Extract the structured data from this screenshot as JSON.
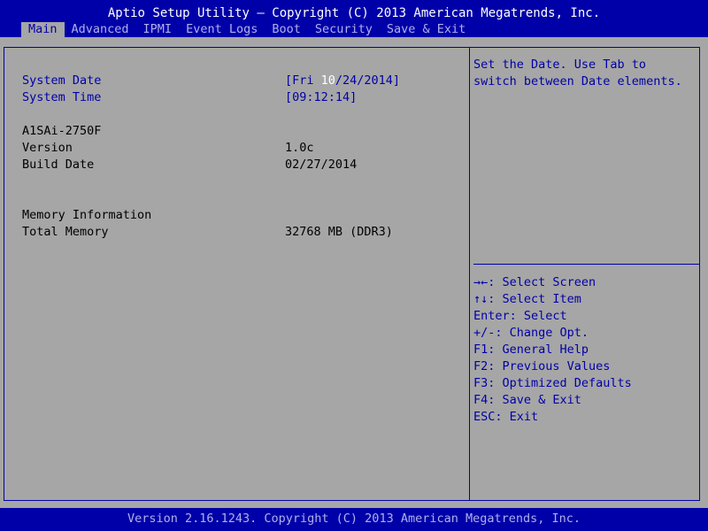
{
  "header": {
    "title": "Aptio Setup Utility – Copyright (C) 2013 American Megatrends, Inc.",
    "tabs": [
      {
        "label": "Main",
        "active": true
      },
      {
        "label": "Advanced"
      },
      {
        "label": "IPMI"
      },
      {
        "label": "Event Logs"
      },
      {
        "label": "Boot"
      },
      {
        "label": "Security"
      },
      {
        "label": "Save & Exit"
      }
    ]
  },
  "main": {
    "system_date": {
      "label": "System Date",
      "value_prefix": "[Fri ",
      "value_highlight": "10",
      "value_suffix": "/24/2014]"
    },
    "system_time": {
      "label": "System Time",
      "value": "[09:12:14]"
    },
    "board_model": "A1SAi-2750F",
    "version": {
      "label": "Version",
      "value": "1.0c"
    },
    "build_date": {
      "label": "Build Date",
      "value": "02/27/2014"
    },
    "memory_heading": "Memory Information",
    "total_memory": {
      "label": "Total Memory",
      "value": "32768 MB (DDR3)"
    }
  },
  "help": {
    "text": "Set the Date. Use Tab to\nswitch between Date elements.",
    "keys": [
      "→←: Select Screen",
      "↑↓: Select Item",
      "Enter: Select",
      "+/-: Change Opt.",
      "F1: General Help",
      "F2: Previous Values",
      "F3: Optimized Defaults",
      "F4: Save & Exit",
      "ESC: Exit"
    ]
  },
  "footer": {
    "text": "Version 2.16.1243. Copyright (C) 2013 American Megatrends, Inc."
  },
  "colors": {
    "background": "#a6a6a6",
    "bar": "#0000a8",
    "accent_text": "#0000a8",
    "highlight": "#ffffff"
  }
}
